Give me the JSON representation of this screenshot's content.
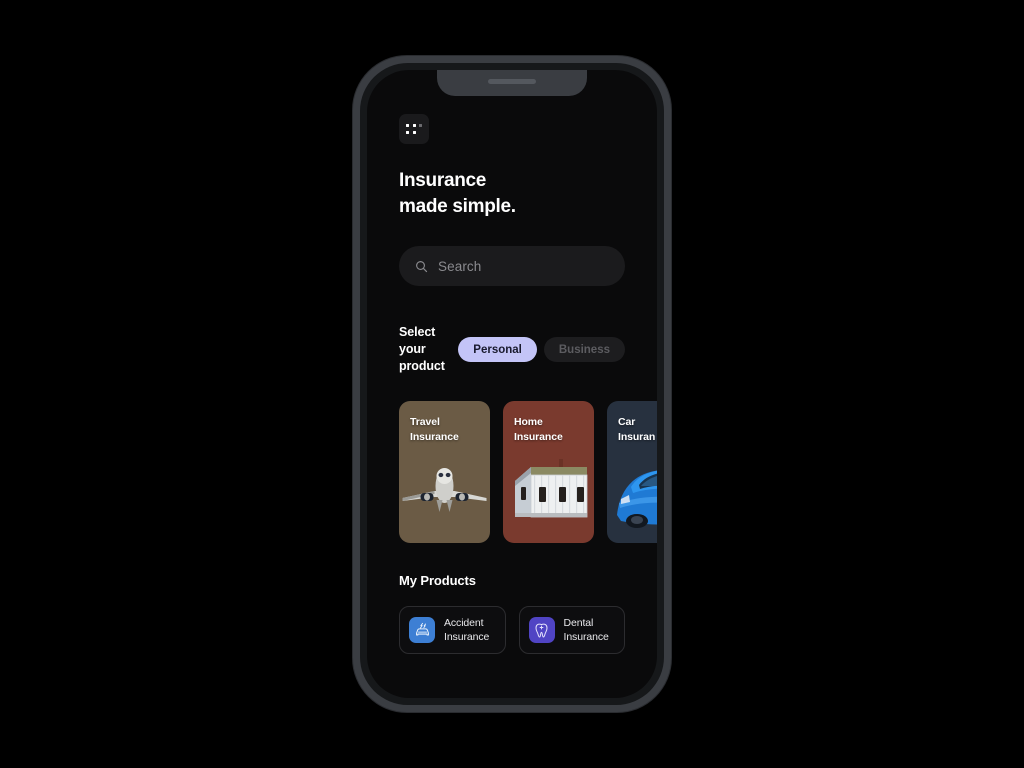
{
  "device": {
    "frame_color": "#3a3d42",
    "screen_bg": "#0a0a0b",
    "notch_name": "phone-notch"
  },
  "header": {
    "menu_icon": "dot-grid-menu-icon",
    "headline_line1": "Insurance",
    "headline_line2": "made simple."
  },
  "search": {
    "icon": "search-icon",
    "placeholder": "Search",
    "value": ""
  },
  "selector": {
    "label_line1": "Select your",
    "label_line2": "product",
    "options": [
      {
        "label": "Personal",
        "active": true,
        "bg": "#c3c4f7",
        "fg": "#191a2e"
      },
      {
        "label": "Business",
        "active": false,
        "bg": "#1d1d1f",
        "fg": "#5c5c60"
      }
    ]
  },
  "products": {
    "items": [
      {
        "title_line1": "Travel",
        "title_line2": "Insurance",
        "art": "airplane",
        "bg": "#6b5b45"
      },
      {
        "title_line1": "Home",
        "title_line2": "Insurance",
        "art": "house",
        "bg": "#7a3a2e"
      },
      {
        "title_line1": "Car",
        "title_line2": "Insuran",
        "art": "car",
        "bg": "#27313f"
      }
    ]
  },
  "my_products": {
    "title": "My Products",
    "items": [
      {
        "label_line1": "Accident",
        "label_line2": "Insurance",
        "icon": "car-crash-icon",
        "icon_bg": "#3d7fd4"
      },
      {
        "label_line1": "Dental",
        "label_line2": "Insurance",
        "icon": "tooth-icon",
        "icon_bg": "#5044c4"
      }
    ]
  },
  "colors": {
    "page_bg": "#000000",
    "accent": "#c3c4f7",
    "text_primary": "#ffffff",
    "text_muted": "#8a8a8e"
  }
}
